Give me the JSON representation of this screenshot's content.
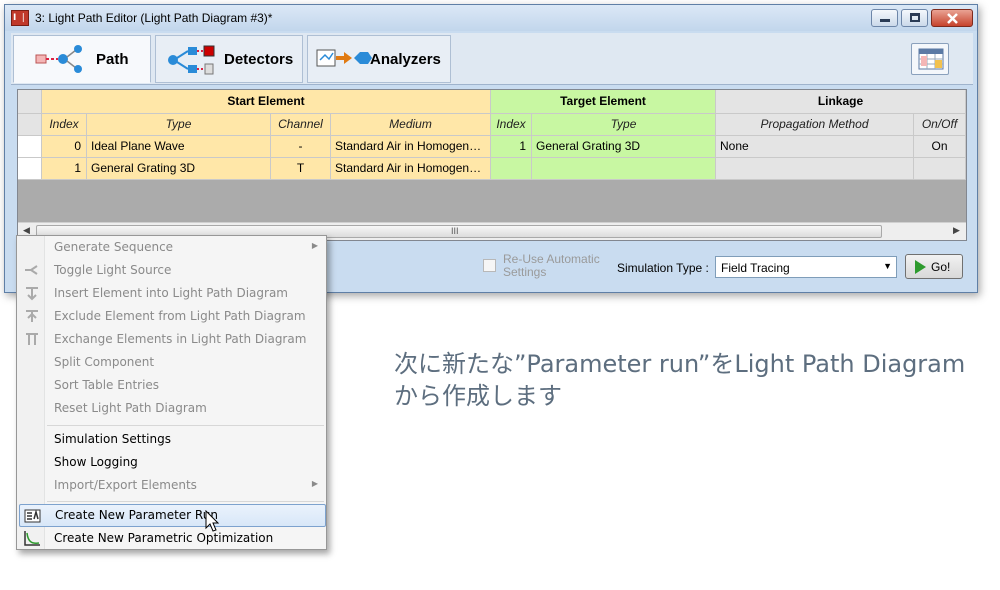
{
  "window": {
    "app_icon_text": "I ❘",
    "title": "3: Light Path Editor (Light Path Diagram #3)*"
  },
  "toolbar": {
    "tabs": [
      {
        "label": "Path",
        "icon": "path-icon"
      },
      {
        "label": "Detectors",
        "icon": "detectors-icon"
      },
      {
        "label": "Analyzers",
        "icon": "analyzers-icon"
      }
    ],
    "settings_icon": "table-settings-icon"
  },
  "table": {
    "groups": {
      "start": "Start Element",
      "target": "Target Element",
      "linkage": "Linkage"
    },
    "columns": {
      "start_index": "Index",
      "start_type": "Type",
      "channel": "Channel",
      "medium": "Medium",
      "target_index": "Index",
      "target_type": "Type",
      "propagation": "Propagation Method",
      "onoff": "On/Off"
    },
    "rows": [
      {
        "start_index": "0",
        "start_type": "Ideal Plane Wave",
        "channel": "-",
        "medium": "Standard Air in Homogen…",
        "target_index": "1",
        "target_type": "General Grating 3D",
        "propagation": "None",
        "onoff": "On"
      },
      {
        "start_index": "1",
        "start_type": "General Grating 3D",
        "channel": "T",
        "medium": "Standard Air in Homogen…",
        "target_index": "",
        "target_type": "",
        "propagation": "",
        "onoff": ""
      }
    ],
    "scroll_thumb_glyph": "III",
    "colors": {
      "start": "#ffe7a8",
      "target": "#c8f7a2",
      "linkage": "#e4e4e4"
    }
  },
  "bottom": {
    "reuse_label": "Re-Use Automatic Settings",
    "simtype_label": "Simulation Type :",
    "simtype_value": "Field Tracing",
    "go_label": "Go!"
  },
  "menu": {
    "group1": [
      {
        "label": "Generate Sequence",
        "disabled": true,
        "submenu": true,
        "icon": ""
      },
      {
        "label": "Toggle Light Source",
        "disabled": true,
        "submenu": false,
        "icon": "toggle-source-icon"
      },
      {
        "label": "Insert Element into Light Path Diagram",
        "disabled": true,
        "submenu": false,
        "icon": "insert-element-icon"
      },
      {
        "label": "Exclude Element from Light Path Diagram",
        "disabled": true,
        "submenu": false,
        "icon": "exclude-element-icon"
      },
      {
        "label": "Exchange Elements in Light Path Diagram",
        "disabled": true,
        "submenu": false,
        "icon": "exchange-elements-icon"
      },
      {
        "label": "Split Component",
        "disabled": true,
        "submenu": false,
        "icon": ""
      },
      {
        "label": "Sort Table Entries",
        "disabled": true,
        "submenu": false,
        "icon": ""
      },
      {
        "label": "Reset Light Path Diagram",
        "disabled": true,
        "submenu": false,
        "icon": ""
      }
    ],
    "group2": [
      {
        "label": "Simulation Settings",
        "disabled": false
      },
      {
        "label": "Show Logging",
        "disabled": false
      },
      {
        "label": "Import/Export Elements",
        "disabled": true,
        "submenu": true
      }
    ],
    "group3": [
      {
        "label": "Create New Parameter Run",
        "disabled": false,
        "highlighted": true,
        "icon": "parameter-run-icon"
      },
      {
        "label": "Create New Parametric Optimization",
        "disabled": false,
        "icon": "parametric-optimization-icon"
      }
    ]
  },
  "caption": {
    "line1": "次に新たな”Parameter run”をLight Path Diagram",
    "line2": "から作成します"
  }
}
